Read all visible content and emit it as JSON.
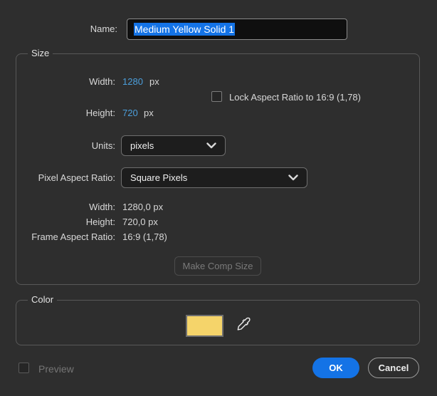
{
  "dialog": {
    "name_label": "Name:",
    "name_value": "Medium Yellow Solid 1",
    "size": {
      "legend": "Size",
      "width_label": "Width:",
      "width_value": "1280",
      "width_unit": "px",
      "lock_label": "Lock Aspect Ratio to 16:9 (1,78)",
      "height_label": "Height:",
      "height_value": "720",
      "height_unit": "px",
      "units_label": "Units:",
      "units_value": "pixels",
      "par_label": "Pixel Aspect Ratio:",
      "par_value": "Square Pixels",
      "info": [
        {
          "label": "Width:",
          "value": "1280,0 px"
        },
        {
          "label": "Height:",
          "value": "720,0 px"
        },
        {
          "label": "Frame Aspect Ratio:",
          "value": "16:9 (1,78)"
        }
      ],
      "make_comp_size_label": "Make Comp Size"
    },
    "color": {
      "legend": "Color",
      "swatch_color": "#F5D46A"
    },
    "footer": {
      "preview_label": "Preview",
      "ok_label": "OK",
      "cancel_label": "Cancel"
    },
    "colors": {
      "accent_blue": "#1473e6",
      "value_blue": "#4b9edb",
      "swatch_yellow": "#F5D46A"
    }
  }
}
